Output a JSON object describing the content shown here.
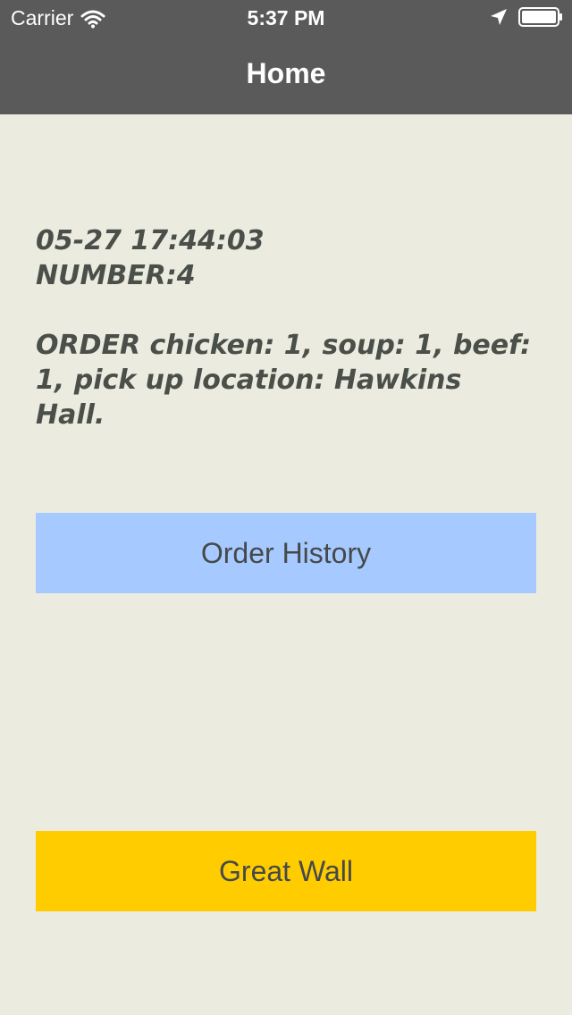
{
  "status_bar": {
    "carrier": "Carrier",
    "time": "5:37 PM",
    "icons": [
      "wifi-icon",
      "location-arrow-icon",
      "battery-icon"
    ]
  },
  "nav": {
    "title": "Home"
  },
  "order": {
    "timestamp": "05-27 17:44:03",
    "number": "NUMBER:4",
    "details_line1": "ORDER chicken: 1, soup: 1, beef:",
    "details_line2": "1, pick up location: Hawkins Hall."
  },
  "buttons": {
    "order_history": "Order History",
    "great_wall": "Great Wall"
  },
  "colors": {
    "background": "#ebebdf",
    "navbar": "#5a5a5a",
    "order_history_button": "#a6c9ff",
    "great_wall_button": "#ffcc00",
    "text": "#4a4f4a"
  }
}
